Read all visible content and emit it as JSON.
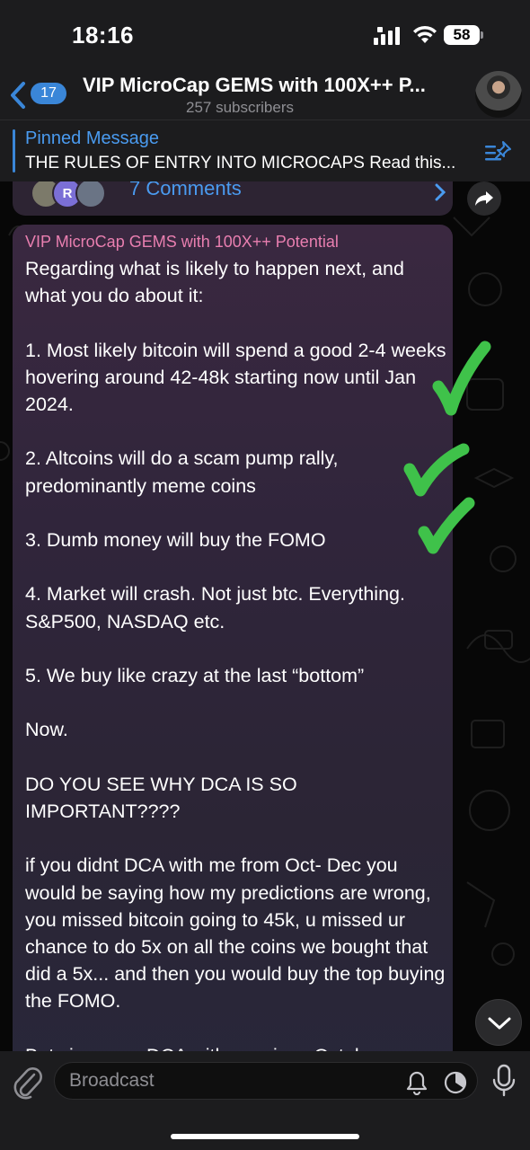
{
  "status_bar": {
    "time": "18:16",
    "battery": "58"
  },
  "header": {
    "back_count": "17",
    "title": "VIP MicroCap GEMS with 100X++ P...",
    "subscribers": "257 subscribers"
  },
  "pinned": {
    "label": "Pinned Message",
    "text": "THE RULES OF ENTRY INTO MICROCAPS Read this..."
  },
  "previous_message": {
    "comment_avatar_letter": "R",
    "comments_label": "7 Comments"
  },
  "message": {
    "sender": "VIP MicroCap GEMS with 100X++ Potential",
    "body": "Regarding what is likely to happen next, and what you do about it:\n\n1. Most likely bitcoin will spend a good 2-4 weeks hovering around 42-48k starting now until Jan 2024.\n\n2. Altcoins will do a scam pump rally, predominantly meme coins\n\n3. Dumb money will buy the FOMO\n\n4. Market will crash. Not just btc. Everything. S&P500, NASDAQ etc.\n\n5. We buy like crazy at the last “bottom”\n\nNow.\n\nDO YOU SEE WHY DCA IS SO IMPORTANT????\n\nif you didnt DCA with me from Oct- Dec you would be saying how my predictions are wrong, you missed bitcoin going to 45k, u missed ur chance to do 5x on all the coins we bought that did a 5x... and then you would buy the top buying the FOMO.\n\nBut since you DCA with me since October"
  },
  "input": {
    "placeholder": "Broadcast"
  },
  "colors": {
    "accent": "#3a86d8",
    "sender": "#e97fb0",
    "checkmark": "#3fc24a"
  }
}
